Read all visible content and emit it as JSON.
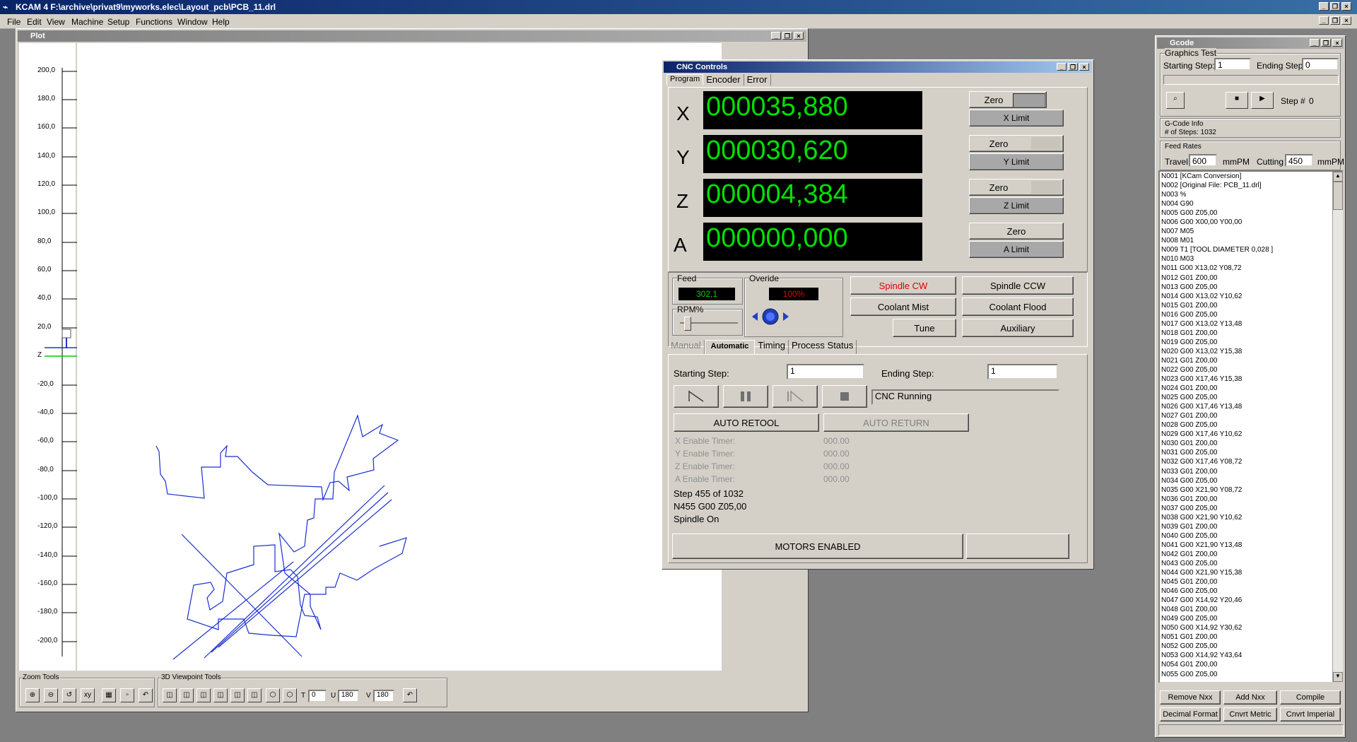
{
  "app": {
    "title": "KCAM 4  F:\\archive\\privat9\\myworks.elec\\Layout_pcb\\PCB_11.drl",
    "menu": [
      "File",
      "Edit",
      "View",
      "Machine",
      "Setup",
      "Functions",
      "Window",
      "Help"
    ]
  },
  "plot": {
    "title": "Plot",
    "axis_labels": [
      "200,0",
      "180,0",
      "160,0",
      "140,0",
      "120,0",
      "100,0",
      "80,0",
      "60,0",
      "40,0",
      "20,0",
      "Z",
      "-20,0",
      "-40,0",
      "-60,0",
      "-80,0",
      "-100,0",
      "-120,0",
      "-140,0",
      "-160,0",
      "-180,0",
      "-200,0"
    ],
    "zoom_tools_label": "Zoom Tools",
    "viewpoint_tools_label": "3D Viewpoint Tools",
    "t_label": "T",
    "t_value": "0",
    "u_label": "U",
    "u_value": "180",
    "v_label": "V",
    "v_value": "180"
  },
  "cnc": {
    "title": "CNC Controls",
    "tabs": [
      "Program",
      "Encoder",
      "Error"
    ],
    "axes": [
      {
        "name": "X",
        "value": "000035,880",
        "zero": "Zero",
        "limit": "X Limit"
      },
      {
        "name": "Y",
        "value": "000030,620",
        "zero": "Zero",
        "limit": "Y Limit"
      },
      {
        "name": "Z",
        "value": "000004,384",
        "zero": "Zero",
        "limit": "Z Limit"
      },
      {
        "name": "A",
        "value": "000000,000",
        "zero": "Zero",
        "limit": "A Limit"
      }
    ],
    "feed_label": "Feed",
    "feed_value": "302,1",
    "override_label": "Overide",
    "override_value": "100%",
    "rpm_label": "RPM%",
    "spindle_cw": "Spindle CW",
    "spindle_ccw": "Spindle CCW",
    "coolant_mist": "Coolant Mist",
    "coolant_flood": "Coolant Flood",
    "tune": "Tune",
    "auxiliary": "Auxiliary",
    "mode_tabs": [
      "Manual",
      "Automatic",
      "Timing",
      "Process Status"
    ],
    "starting_step_label": "Starting Step:",
    "starting_step_value": "1",
    "ending_step_label": "Ending Step:",
    "ending_step_value": "1",
    "status_text": "CNC Running",
    "auto_retool": "AUTO RETOOL",
    "auto_return": "AUTO RETURN",
    "timers": [
      {
        "label": "X Enable Timer:",
        "value": "000.00"
      },
      {
        "label": "Y Enable Timer:",
        "value": "000.00"
      },
      {
        "label": "Z Enable Timer:",
        "value": "000.00"
      },
      {
        "label": "A Enable Timer:",
        "value": "000.00"
      }
    ],
    "step_info": "Step 455 of 1032",
    "current_line": "N455 G00 Z05,00",
    "spindle_state": "Spindle On",
    "motors": "MOTORS ENABLED"
  },
  "gcode": {
    "title": "Gcode",
    "graphics_test_label": "Graphics Test",
    "starting_step_label": "Starting Step:",
    "starting_step_value": "1",
    "ending_step_label": "Ending Step:",
    "ending_step_value": "0",
    "step_label": "Step #",
    "step_value": "0",
    "info_label": "G-Code Info",
    "num_steps": "# of Steps:   1032",
    "feed_rates_label": "Feed Rates",
    "travel_label": "Travel",
    "travel_value": "600",
    "travel_unit": "mmPM",
    "cutting_label": "Cutting",
    "cutting_value": "450",
    "cutting_unit": "mmPM",
    "lines": [
      "N001 [KCam Conversion]",
      "N002 [Original File: PCB_11.drl]",
      "N003 %",
      "N004 G90",
      "N005 G00 Z05,00",
      "N006 G00 X00,00 Y00,00",
      "N007 M05",
      "N008 M01",
      "N009 T1 [TOOL DIAMETER 0,028 ]",
      "N010 M03",
      "N011 G00 X13,02 Y08,72",
      "N012 G01 Z00,00",
      "N013 G00 Z05,00",
      "N014 G00 X13,02 Y10,62",
      "N015 G01 Z00,00",
      "N016 G00 Z05,00",
      "N017 G00 X13,02 Y13,48",
      "N018 G01 Z00,00",
      "N019 G00 Z05,00",
      "N020 G00 X13,02 Y15,38",
      "N021 G01 Z00,00",
      "N022 G00 Z05,00",
      "N023 G00 X17,46 Y15,38",
      "N024 G01 Z00,00",
      "N025 G00 Z05,00",
      "N026 G00 X17,46 Y13,48",
      "N027 G01 Z00,00",
      "N028 G00 Z05,00",
      "N029 G00 X17,46 Y10,62",
      "N030 G01 Z00,00",
      "N031 G00 Z05,00",
      "N032 G00 X17,46 Y08,72",
      "N033 G01 Z00,00",
      "N034 G00 Z05,00",
      "N035 G00 X21,90 Y08,72",
      "N036 G01 Z00,00",
      "N037 G00 Z05,00",
      "N038 G00 X21,90 Y10,62",
      "N039 G01 Z00,00",
      "N040 G00 Z05,00",
      "N041 G00 X21,90 Y13,48",
      "N042 G01 Z00,00",
      "N043 G00 Z05,00",
      "N044 G00 X21,90 Y15,38",
      "N045 G01 Z00,00",
      "N046 G00 Z05,00",
      "N047 G00 X14,92 Y20,46",
      "N048 G01 Z00,00",
      "N049 G00 Z05,00",
      "N050 G00 X14,92 Y30,62",
      "N051 G01 Z00,00",
      "N052 G00 Z05,00",
      "N053 G00 X14,92 Y43,64",
      "N054 G01 Z00,00",
      "N055 G00 Z05,00"
    ],
    "remove_nxx": "Remove  Nxx",
    "add_nxx": "Add Nxx",
    "compile": "Compile",
    "decimal_format": "Decimal Format",
    "cnvrt_metric": "Cnvrt Metric",
    "cnvrt_imperial": "Cnvrt Imperial"
  }
}
